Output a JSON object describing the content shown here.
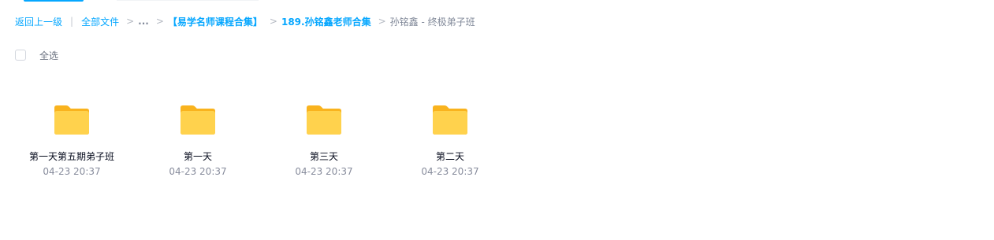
{
  "breadcrumb": {
    "back": "返回上一级",
    "all_files": "全部文件",
    "ellipsis": "...",
    "folder_1": "【易学名师课程合集】",
    "folder_2": "189.孙铭鑫老师合集",
    "current": "孙铭鑫 - 终极弟子班"
  },
  "selection": {
    "select_all_label": "全选"
  },
  "files": [
    {
      "name": "第一天第五期弟子班",
      "time": "04-23 20:37"
    },
    {
      "name": "第一天",
      "time": "04-23 20:37"
    },
    {
      "name": "第三天",
      "time": "04-23 20:37"
    },
    {
      "name": "第二天",
      "time": "04-23 20:37"
    }
  ],
  "colors": {
    "accent": "#06a7ff",
    "folder_back": "#f9b31e",
    "folder_front": "#ffd24d"
  },
  "icons": {
    "folder": "folder-icon"
  }
}
